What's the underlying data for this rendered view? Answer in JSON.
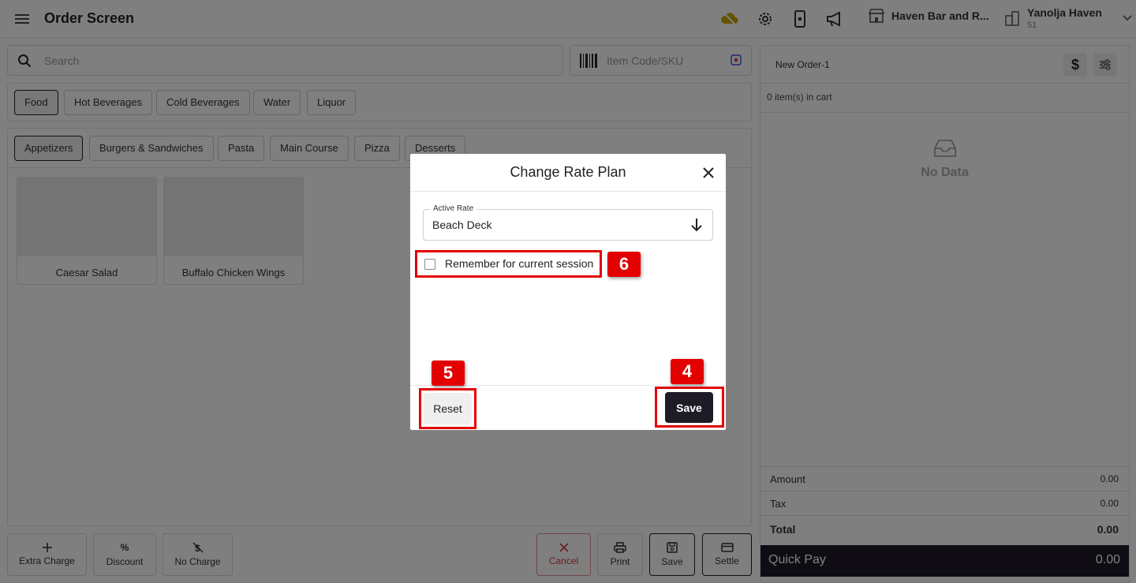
{
  "header": {
    "title": "Order Screen",
    "store_name": "Haven Bar and R...",
    "property_name": "Yanolja Haven",
    "property_sub": "51"
  },
  "search": {
    "placeholder": "Search"
  },
  "sku": {
    "placeholder": "Item Code/SKU"
  },
  "categories": [
    "Food",
    "Hot Beverages",
    "Cold Beverages",
    "Water",
    "Liquor"
  ],
  "subcategories": [
    "Appetizers",
    "Burgers & Sandwiches",
    "Pasta",
    "Main Course",
    "Pizza",
    "Desserts"
  ],
  "items": [
    "Caesar Salad",
    "Buffalo Chicken Wings"
  ],
  "actions": {
    "extra_charge": "Extra Charge",
    "discount": "Discount",
    "discount_symbol": "%",
    "no_charge": "No Charge",
    "cancel": "Cancel",
    "print": "Print",
    "save": "Save",
    "settle": "Settle"
  },
  "cart": {
    "order_name": "New Order-1",
    "currency_symbol": "$",
    "count_text": "0 item(s) in cart",
    "empty_text": "No Data",
    "amount_label": "Amount",
    "amount_value": "0.00",
    "tax_label": "Tax",
    "tax_value": "0.00",
    "total_label": "Total",
    "total_value": "0.00",
    "quick_pay_label": "Quick Pay",
    "quick_pay_value": "0.00"
  },
  "modal": {
    "title": "Change Rate Plan",
    "active_rate_label": "Active Rate",
    "active_rate_value": "Beach Deck",
    "remember_label": "Remember for current session",
    "remember_checked": false,
    "reset_label": "Reset",
    "save_label": "Save"
  },
  "annotations": {
    "badge_4": "4",
    "badge_5": "5",
    "badge_6": "6"
  },
  "colors": {
    "accent_dark": "#1e1a26",
    "highlight_red": "#e30000",
    "cancel_red": "#d93b3b"
  }
}
